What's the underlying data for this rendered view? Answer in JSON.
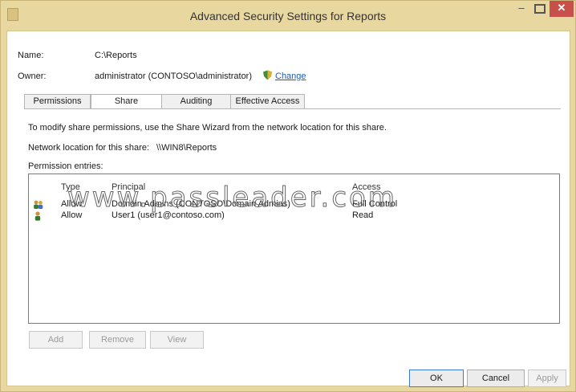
{
  "window": {
    "title": "Advanced Security Settings for Reports"
  },
  "titlebar": {
    "minimize": "–",
    "close": "✕"
  },
  "name": {
    "label": "Name:",
    "value": "C:\\Reports"
  },
  "owner": {
    "label": "Owner:",
    "value": "administrator (CONTOSO\\administrator)",
    "change": "Change"
  },
  "tabs": [
    {
      "label": "Permissions"
    },
    {
      "label": "Share"
    },
    {
      "label": "Auditing"
    },
    {
      "label": "Effective Access"
    }
  ],
  "info": {
    "line1": "To modify share permissions, use the Share Wizard from the network location for this share.",
    "network_label": "Network location for this share:",
    "network_value": "\\\\WIN8\\Reports",
    "entries_label": "Permission entries:"
  },
  "table": {
    "headers": {
      "type": "Type",
      "principal": "Principal",
      "access": "Access"
    },
    "rows": [
      {
        "type": "Allow",
        "principal": "Domain Admins (CONTOSO\\Domain Admins)",
        "access": "Full Control",
        "icon": "group-icon"
      },
      {
        "type": "Allow",
        "principal": "User1 (user1@contoso.com)",
        "access": "Read",
        "icon": "user-icon"
      }
    ]
  },
  "buttons": {
    "add": "Add",
    "remove": "Remove",
    "view": "View",
    "ok": "OK",
    "cancel": "Cancel",
    "apply": "Apply"
  },
  "watermark": "www.passleader.com",
  "colors": {
    "frame": "#e9d7a0",
    "close": "#c7504a",
    "link": "#1f5bb5"
  }
}
